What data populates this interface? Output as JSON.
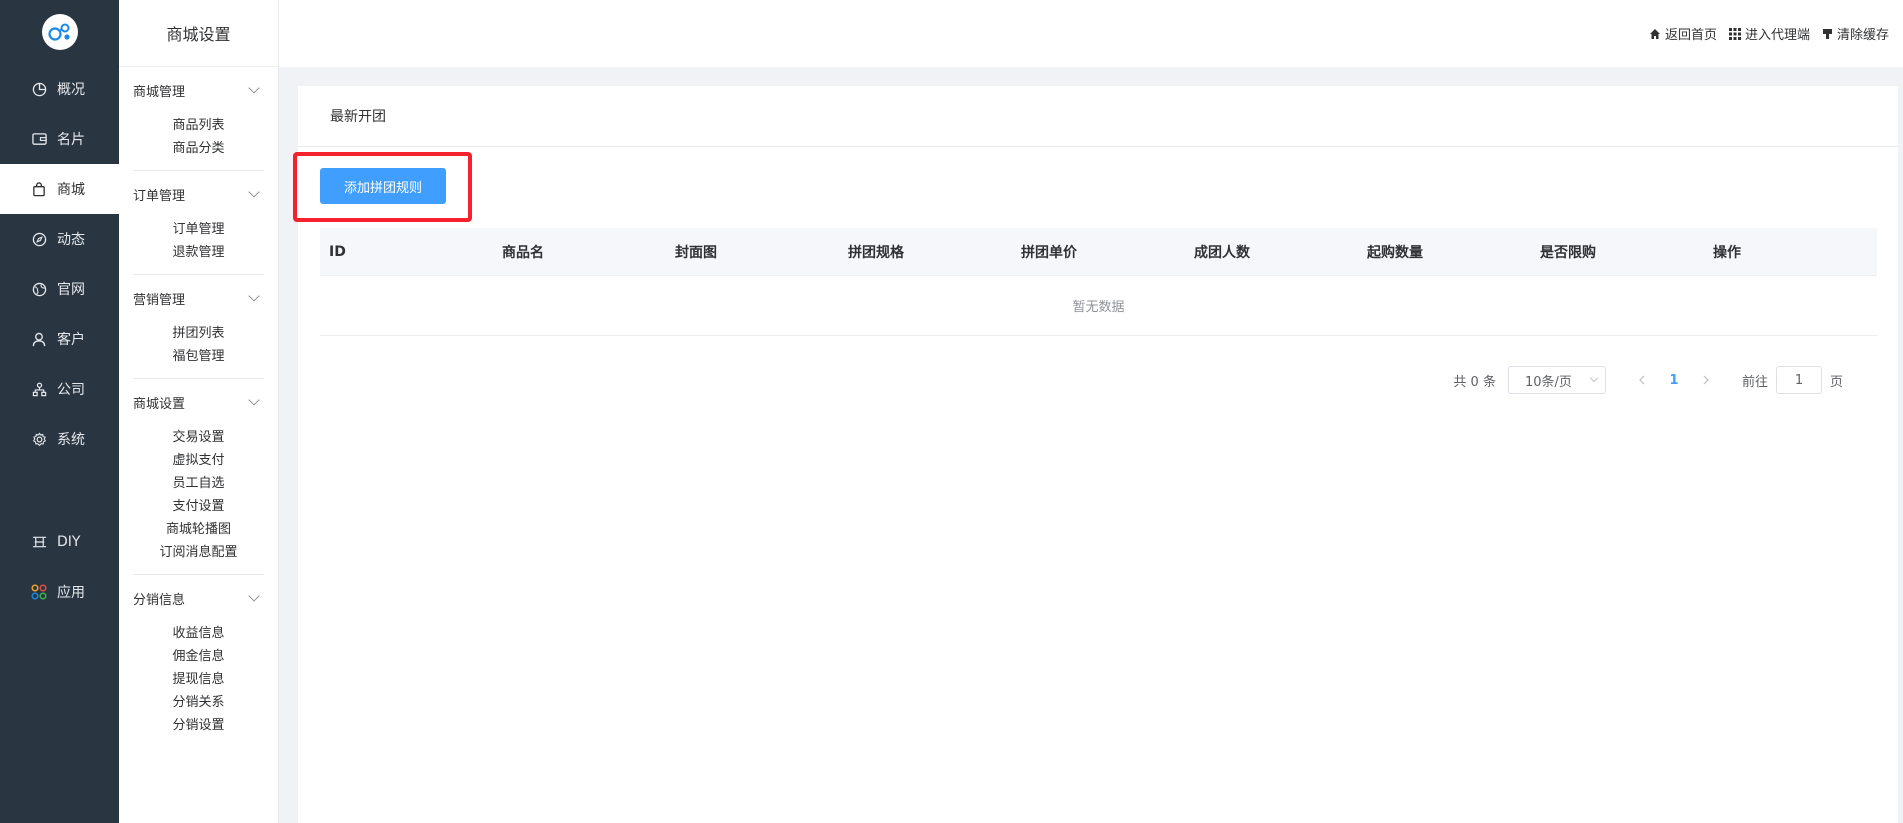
{
  "nav": {
    "items": [
      {
        "label": "概况",
        "icon": "pie-chart-icon"
      },
      {
        "label": "名片",
        "icon": "wallet-icon"
      },
      {
        "label": "商城",
        "icon": "shopping-bag-icon",
        "active": true
      },
      {
        "label": "动态",
        "icon": "compass-icon"
      },
      {
        "label": "官网",
        "icon": "globe-icon"
      },
      {
        "label": "客户",
        "icon": "user-icon"
      },
      {
        "label": "公司",
        "icon": "org-tree-icon"
      },
      {
        "label": "系统",
        "icon": "gear-icon"
      }
    ],
    "bottom": [
      {
        "label": "DIY",
        "icon": "diy-icon"
      },
      {
        "label": "应用",
        "icon": "apps-grid-icon"
      }
    ]
  },
  "sidebar": {
    "title": "商城设置",
    "groups": [
      {
        "title": "商城管理",
        "items": [
          "商品列表",
          "商品分类"
        ]
      },
      {
        "title": "订单管理",
        "items": [
          "订单管理",
          "退款管理"
        ]
      },
      {
        "title": "营销管理",
        "items": [
          "拼团列表",
          "福包管理"
        ]
      },
      {
        "title": "商城设置",
        "items": [
          "交易设置",
          "虚拟支付",
          "员工自选",
          "支付设置",
          "商城轮播图",
          "订阅消息配置"
        ]
      },
      {
        "title": "分销信息",
        "items": [
          "收益信息",
          "佣金信息",
          "提现信息",
          "分销关系",
          "分销设置"
        ]
      }
    ]
  },
  "topbar": {
    "home": "返回首页",
    "agent": "进入代理端",
    "clear": "清除缓存"
  },
  "main": {
    "tab_title": "最新开团",
    "add_button": "添加拼团规则",
    "columns": [
      "ID",
      "商品名",
      "封面图",
      "拼团规格",
      "拼团单价",
      "成团人数",
      "起购数量",
      "是否限购",
      "操作"
    ],
    "empty_text": "暂无数据",
    "pagination": {
      "total": "共 0 条",
      "page_size": "10条/页",
      "current_page": "1",
      "goto_prefix": "前往",
      "goto_value": "1",
      "goto_suffix": "页"
    }
  },
  "colors": {
    "nav_bg": "#293642",
    "primary": "#409eff",
    "highlight": "#f5222d"
  }
}
